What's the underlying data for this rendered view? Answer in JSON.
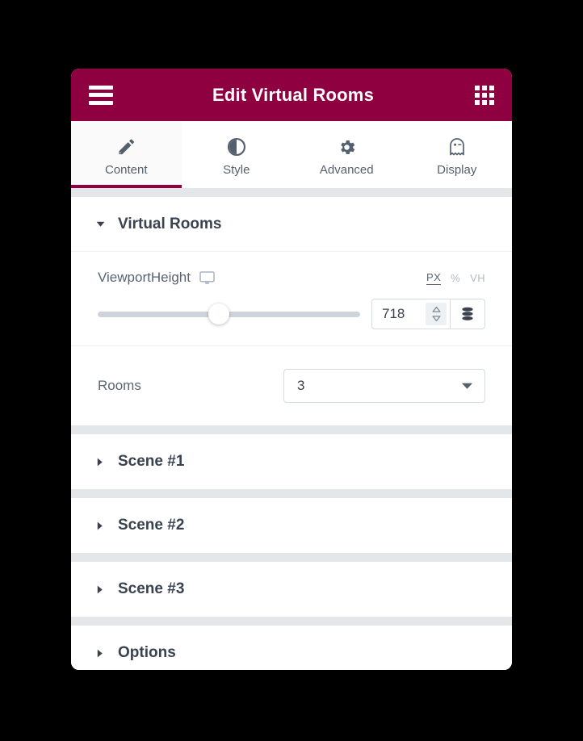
{
  "window": {
    "title": "Edit Virtual Rooms",
    "menu_icon": "hamburger-menu-icon",
    "apps_icon": "grid-apps-icon",
    "accent_color": "#8e0040"
  },
  "tabs": [
    {
      "label": "Content",
      "icon": "pencil-icon",
      "active": true
    },
    {
      "label": "Style",
      "icon": "contrast-icon",
      "active": false
    },
    {
      "label": "Advanced",
      "icon": "gear-icon",
      "active": false
    },
    {
      "label": "Display",
      "icon": "ghost-icon",
      "active": false
    }
  ],
  "sections": {
    "virtual_rooms": {
      "title": "Virtual Rooms",
      "expanded": true,
      "viewport_height": {
        "label": "ViewportHeight",
        "device_icon": "desktop-monitor-icon",
        "units": [
          {
            "label": "PX",
            "active": true
          },
          {
            "label": "%",
            "active": false
          },
          {
            "label": "VH",
            "active": false
          }
        ],
        "value": "718",
        "slider_percent": 46,
        "spinner_icon": "up-down-spinner-icon",
        "dynamic_icon": "database-stack-icon"
      },
      "rooms": {
        "label": "Rooms",
        "value": "3",
        "chevron_icon": "chevron-down-icon"
      }
    },
    "collapsed": [
      {
        "title": "Scene #1",
        "caret_icon": "caret-right-icon"
      },
      {
        "title": "Scene #2",
        "caret_icon": "caret-right-icon"
      },
      {
        "title": "Scene #3",
        "caret_icon": "caret-right-icon"
      },
      {
        "title": "Options",
        "caret_icon": "caret-right-icon"
      }
    ]
  }
}
